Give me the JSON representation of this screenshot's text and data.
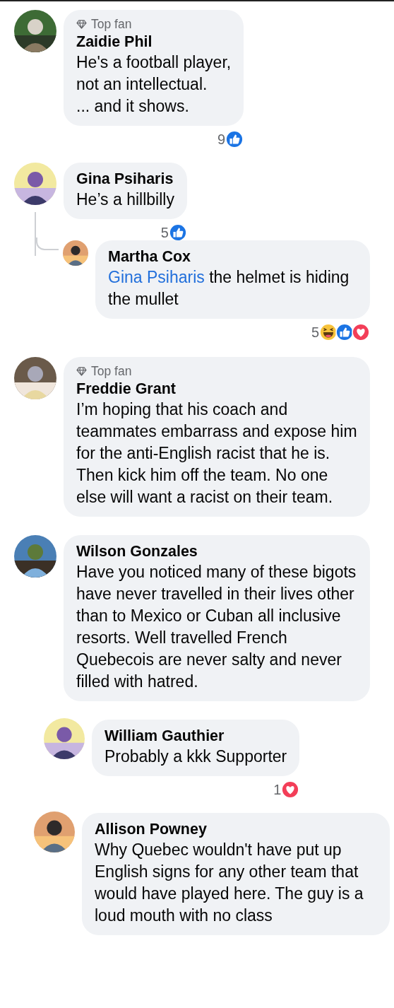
{
  "comments": [
    {
      "badge": "Top fan",
      "name": "Zaidie Phil",
      "text": "He's a football player,\nnot an intellectual.\n... and it shows.",
      "reactions": {
        "count": "9",
        "icons": [
          {
            "kind": "like"
          }
        ]
      },
      "thread_line": false
    },
    {
      "name": "Gina Psiharis",
      "text": "He’s a hillbilly",
      "reactions": {
        "count": "5",
        "icons": [
          {
            "kind": "like"
          }
        ]
      },
      "thread_line": true,
      "children": [
        {
          "name": "Martha Cox",
          "mention": "Gina Psiharis",
          "text": "the helmet is hiding the mullet",
          "reactions": {
            "count": "5",
            "icons": [
              {
                "kind": "haha"
              },
              {
                "kind": "like"
              },
              {
                "kind": "love"
              }
            ]
          }
        }
      ]
    },
    {
      "badge": "Top fan",
      "name": "Freddie Grant",
      "text": "I’m hoping that his coach and teammates embarrass and expose him for the anti-English racist that he is. Then kick him off the team. No one else will want a racist on their team.",
      "thread_line": false
    },
    {
      "name": "Wilson Gonzales",
      "text": "Have you noticed many of these bigots have never travelled in their lives other than to Mexico or Cuban all inclusive resorts. Well travelled French Quebecois are never salty and never filled with hatred.",
      "thread_line": false,
      "children": [
        {
          "name": "William Gauthier",
          "text": "Probably a kkk Supporter",
          "reactions": {
            "count": "1",
            "icons": [
              {
                "kind": "love"
              }
            ]
          }
        },
        {
          "name": "Allison Powney",
          "text": "Why Quebec wouldn't have put up English signs for any other team that would have played here. The guy is a loud mouth with no class"
        }
      ]
    }
  ]
}
